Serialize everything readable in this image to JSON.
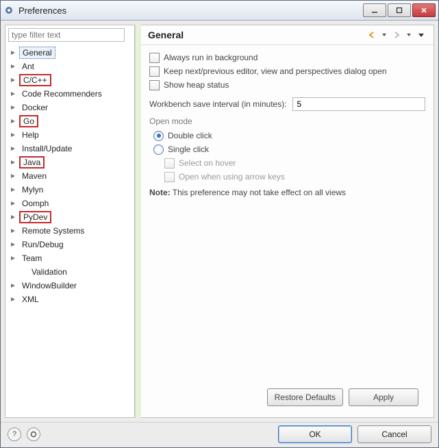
{
  "window": {
    "title": "Preferences"
  },
  "filter": {
    "placeholder": "type filter text"
  },
  "tree": {
    "items": [
      {
        "label": "General",
        "sel": true
      },
      {
        "label": "Ant"
      },
      {
        "label": "C/C++",
        "red": true
      },
      {
        "label": "Code Recommenders"
      },
      {
        "label": "Docker"
      },
      {
        "label": "Go",
        "red": true
      },
      {
        "label": "Help"
      },
      {
        "label": "Install/Update"
      },
      {
        "label": "Java",
        "red": true
      },
      {
        "label": "Maven"
      },
      {
        "label": "Mylyn"
      },
      {
        "label": "Oomph"
      },
      {
        "label": "PyDev",
        "red": true
      },
      {
        "label": "Remote Systems"
      },
      {
        "label": "Run/Debug"
      },
      {
        "label": "Team"
      },
      {
        "label": "Validation",
        "leaf": true,
        "indent": true
      },
      {
        "label": "WindowBuilder"
      },
      {
        "label": "XML"
      }
    ]
  },
  "page": {
    "heading": "General",
    "chk_bg": "Always run in background",
    "chk_keep": "Keep next/previous editor, view and perspectives dialog open",
    "chk_heap": "Show heap status",
    "save_label": "Workbench save interval (in minutes):",
    "save_value": "5",
    "open_mode": "Open mode",
    "r_double": "Double click",
    "r_single": "Single click",
    "sub_hover": "Select on hover",
    "sub_arrow": "Open when using arrow keys",
    "note_b": "Note:",
    "note_t": "This preference may not take effect on all views",
    "restore": "Restore Defaults",
    "apply": "Apply"
  },
  "footer": {
    "ok": "OK",
    "cancel": "Cancel"
  }
}
